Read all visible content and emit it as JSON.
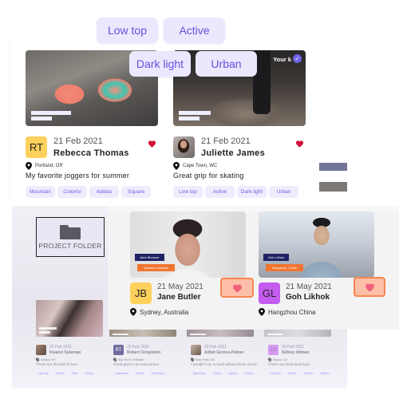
{
  "chips": [
    "Low top",
    "Active",
    "Dark light",
    "Urban"
  ],
  "top_cards": [
    {
      "date": "21 Feb 2021",
      "name": "Rebecca Thomas",
      "initials": "RT",
      "avatar_color": "#fdd15c",
      "location": "Portland, OR",
      "description": "My favorite joggers for summer",
      "tags": [
        "Mountain",
        "Colorful",
        "Adidas",
        "Square"
      ],
      "liked": true
    },
    {
      "date": "21 Feb 2021",
      "name": "Juliette James",
      "initials": "",
      "location": "Cape Town, WC",
      "description": "Great grip for skating",
      "tags": [
        "Low top",
        "Active",
        "Dark light",
        "Urban"
      ],
      "liked": true,
      "badge_text": "Your k",
      "verified": true
    }
  ],
  "project_folder": {
    "label": "PROJECT FOLDER"
  },
  "speakers": [
    {
      "date": "21 May 2021",
      "name": "Jane Butler",
      "initials": "JB",
      "avatar_color": "#fdd15c",
      "location": "Sydney, Australia",
      "overlay_name": "Jane Bloomer",
      "overlay_location": "Sydney, Australia"
    },
    {
      "date": "21 May 2021",
      "name": "Goh Likhok",
      "initials": "GL",
      "avatar_color": "#c45cf0",
      "location": "Hangzhou China",
      "overlay_name": "Goh Likhok",
      "overlay_location": "Hangzhou, China"
    }
  ],
  "back_cards": [
    {
      "date": "20 Feb 2021",
      "name": "Kwanzi Soleman",
      "initials": "",
      "location": "Newton, NY",
      "description": "These are the best fit ever",
      "tags": [
        "Low top",
        "Active",
        "Pink",
        "Yellow"
      ]
    },
    {
      "date": "20 Feb 2021",
      "name": "Robert Templeton",
      "initials": "RT",
      "avatar_color": "#6f6b9e",
      "location": "Bay Shore, Brisbane",
      "description": "Great grip to run everywhere",
      "tags": [
        "Marathon",
        "Active",
        "Structural"
      ]
    },
    {
      "date": "20 Feb 2021",
      "name": "Adiah Gomes-Patton",
      "initials": "",
      "location": "Sioux Falls, SD",
      "description": "I wouldn't run so well without these shoes",
      "tags": [
        "Marathon",
        "Active",
        "Sports",
        "Yellow"
      ]
    },
    {
      "date": "20 Feb 2021",
      "name": "Sidney Altman",
      "initials": "CS",
      "avatar_color": "#d69af2",
      "location": "Boston, CA",
      "description": "Check out these bad boys",
      "tags": [
        "Colorful",
        "Active",
        "Trainer",
        "Yellow"
      ]
    }
  ],
  "colors": {
    "accent": "#6251e0",
    "chip_bg": "#ebe8fd",
    "heart": "#d0103a",
    "like_bg": "#fdbfa8",
    "like_border": "#f7864e",
    "name_tag": "#1f2266",
    "location_tag": "#f07530"
  }
}
